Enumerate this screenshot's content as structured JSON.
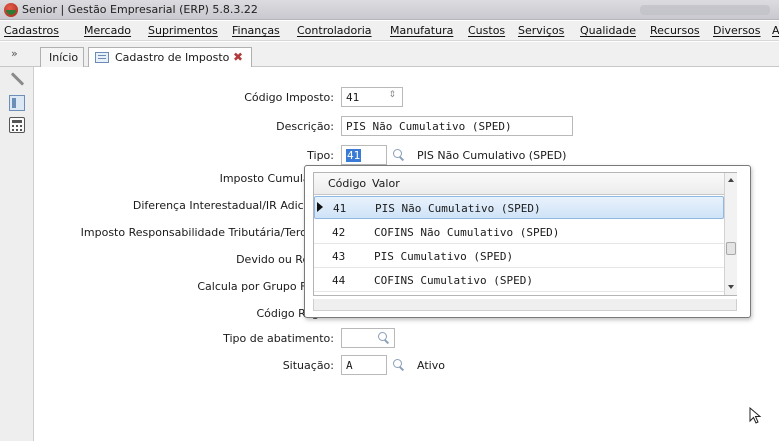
{
  "window": {
    "title": "Senior | Gestão Empresarial (ERP) 5.8.3.22"
  },
  "menu": [
    "Cadastros",
    "Mercado",
    "Suprimentos",
    "Finanças",
    "Controladoria",
    "Manufatura",
    "Custos",
    "Serviços",
    "Qualidade",
    "Recursos",
    "Diversos",
    "A"
  ],
  "tabs": {
    "home": "Início",
    "active": "Cadastro de Imposto"
  },
  "form": {
    "codigo_imposto_label": "Código Imposto:",
    "codigo_imposto_value": "41",
    "descricao_label": "Descrição:",
    "descricao_value": "PIS Não Cumulativo (SPED)",
    "tipo_label": "Tipo:",
    "tipo_value": "41",
    "tipo_desc": "PIS Não Cumulativo (SPED)",
    "imposto_cumulativo_label": "Imposto Cumulativo:",
    "diferenca_label": "Diferença Interestadual/IR Adicional:",
    "resp_trib_label": "Imposto Responsabilidade Tributária/Terciário:",
    "devido_label": "Devido ou Retido:",
    "grupo_fiscal_label": "Calcula por Grupo Fiscal:",
    "codigo_regra_label": "Código Regra:",
    "tipo_abatimento_label": "Tipo de abatimento:",
    "situacao_label": "Situação:",
    "situacao_value": "A",
    "situacao_desc": "Ativo"
  },
  "lookup": {
    "columns": [
      "Código",
      "Valor"
    ],
    "rows": [
      {
        "code": "41",
        "value": "PIS Não Cumulativo (SPED)"
      },
      {
        "code": "42",
        "value": "COFINS Não Cumulativo (SPED)"
      },
      {
        "code": "43",
        "value": "PIS Cumulativo (SPED)"
      },
      {
        "code": "44",
        "value": "COFINS Cumulativo (SPED)"
      }
    ],
    "selected_code": "41"
  },
  "icons": {
    "app": "senior-app-icon",
    "tab_close": "close-icon",
    "lookup": "search-icon",
    "tools": [
      "wrench-icon",
      "panel-icon",
      "calculator-icon"
    ]
  },
  "colors": {
    "selection": "#3a7bd5",
    "row_highlight": "#cfe3f7"
  }
}
